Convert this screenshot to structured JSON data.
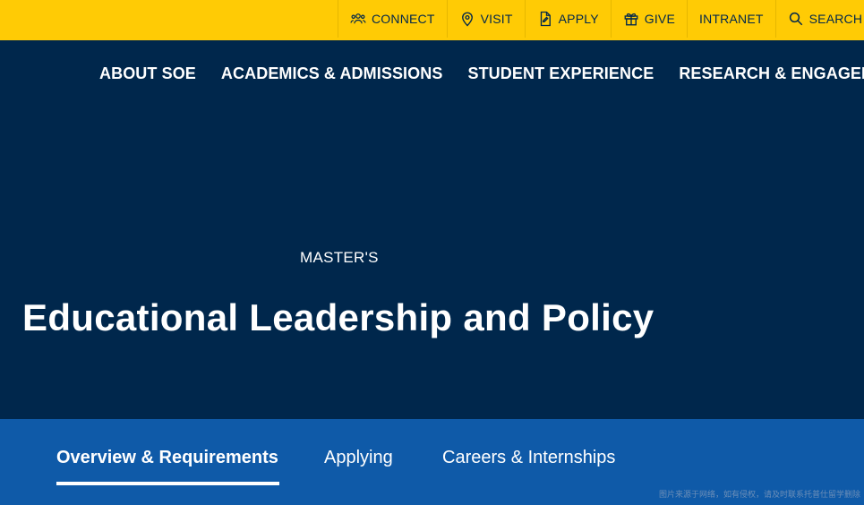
{
  "utility": {
    "items": [
      {
        "label": "CONNECT",
        "icon": "people-icon"
      },
      {
        "label": "VISIT",
        "icon": "map-pin-icon"
      },
      {
        "label": "APPLY",
        "icon": "document-icon"
      },
      {
        "label": "GIVE",
        "icon": "gift-icon"
      },
      {
        "label": "INTRANET",
        "icon": ""
      },
      {
        "label": "SEARCH",
        "icon": "search-icon"
      }
    ]
  },
  "main_nav": {
    "items": [
      "ABOUT SOE",
      "ACADEMICS & ADMISSIONS",
      "STUDENT EXPERIENCE",
      "RESEARCH & ENGAGEMENT"
    ]
  },
  "hero": {
    "eyebrow": "MASTER'S",
    "title": "Educational Leadership and Policy"
  },
  "subnav": {
    "tabs": [
      "Overview & Requirements",
      "Applying",
      "Careers & Internships"
    ],
    "active_index": 0
  },
  "watermark": "图片来源于网络，如有侵权，请及时联系托普仕留学删除",
  "colors": {
    "maize": "#ffcb05",
    "blue": "#00274c",
    "subnav_blue": "#0f5aa8"
  }
}
